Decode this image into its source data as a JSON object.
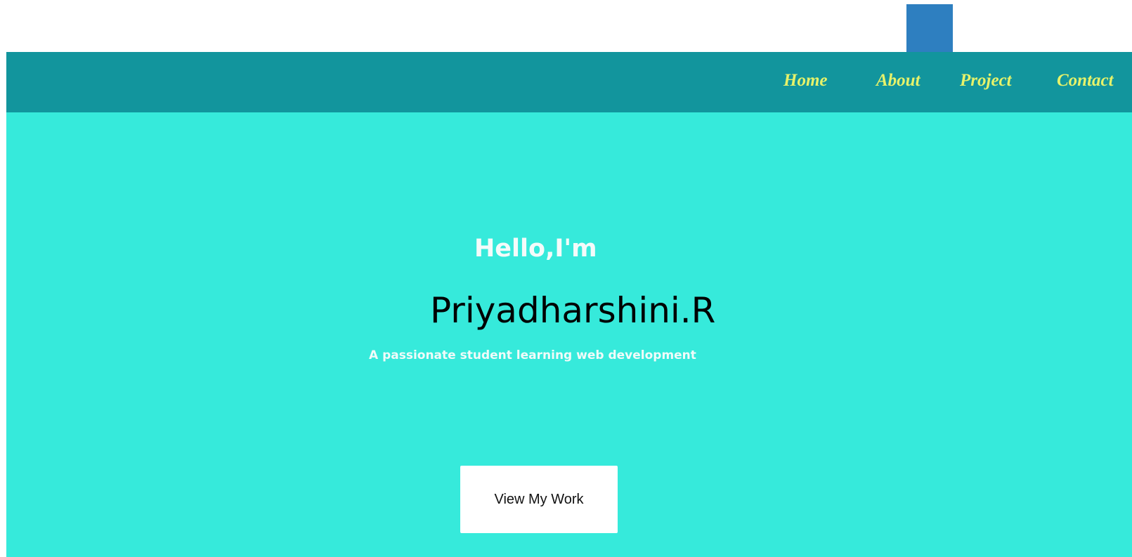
{
  "nav": {
    "items": [
      {
        "label": "Home"
      },
      {
        "label": "About"
      },
      {
        "label": "Project"
      },
      {
        "label": "Contact"
      }
    ]
  },
  "hero": {
    "greeting": "Hello,I'm",
    "name": "Priyadharshini.R",
    "tagline": "A passionate student learning web development",
    "cta_label": "View My Work"
  },
  "colors": {
    "nav_background": "#12959d",
    "nav_link": "#e6f26a",
    "hero_background": "#36eadb",
    "top_block": "#2e7fc0",
    "button_background": "#ffffff"
  }
}
